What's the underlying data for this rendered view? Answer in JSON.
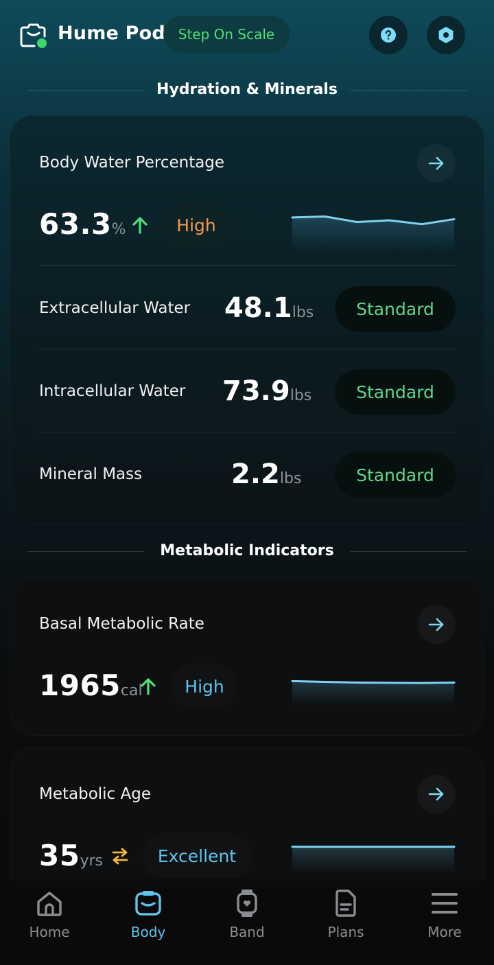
{
  "header": {
    "app_title": "Hume Pod",
    "step_button": "Step On Scale",
    "help_icon": "help-icon",
    "settings_icon": "settings-icon"
  },
  "sections": {
    "hydration_title": "Hydration & Minerals",
    "metabolic_title": "Metabolic Indicators"
  },
  "body_water": {
    "title": "Body Water Percentage",
    "value": "63.3",
    "unit": "%",
    "trend": "up",
    "status": "High",
    "sparkline": [
      0.72,
      0.78,
      0.45,
      0.55,
      0.32,
      0.62
    ]
  },
  "rows": [
    {
      "label": "Extracellular Water",
      "value": "48.1",
      "unit": "lbs",
      "status": "Standard"
    },
    {
      "label": "Intracellular Water",
      "value": "73.9",
      "unit": "lbs",
      "status": "Standard"
    },
    {
      "label": "Mineral Mass",
      "value": "2.2",
      "unit": "lbs",
      "status": "Standard"
    }
  ],
  "bmr": {
    "title": "Basal Metabolic Rate",
    "value": "1965",
    "unit": "cal",
    "trend": "up",
    "status": "High",
    "sparkline": [
      0.6,
      0.55,
      0.5,
      0.48,
      0.47,
      0.5
    ]
  },
  "metabolic_age": {
    "title": "Metabolic Age",
    "value": "35",
    "unit": "yrs",
    "trend": "same",
    "status": "Excellent",
    "sparkline": [
      0.5,
      0.5,
      0.5,
      0.5,
      0.5,
      0.5
    ]
  },
  "nav": [
    {
      "label": "Home",
      "icon": "home-icon"
    },
    {
      "label": "Body",
      "icon": "body-icon",
      "active": true
    },
    {
      "label": "Band",
      "icon": "band-icon"
    },
    {
      "label": "Plans",
      "icon": "plans-icon"
    },
    {
      "label": "More",
      "icon": "menu-icon"
    }
  ],
  "colors": {
    "accent_blue": "#5dc4ee",
    "status_green": "#62d58a",
    "status_orange": "#f0974f",
    "trend_up": "#4ee07a",
    "trend_same": "#f5b63a"
  }
}
